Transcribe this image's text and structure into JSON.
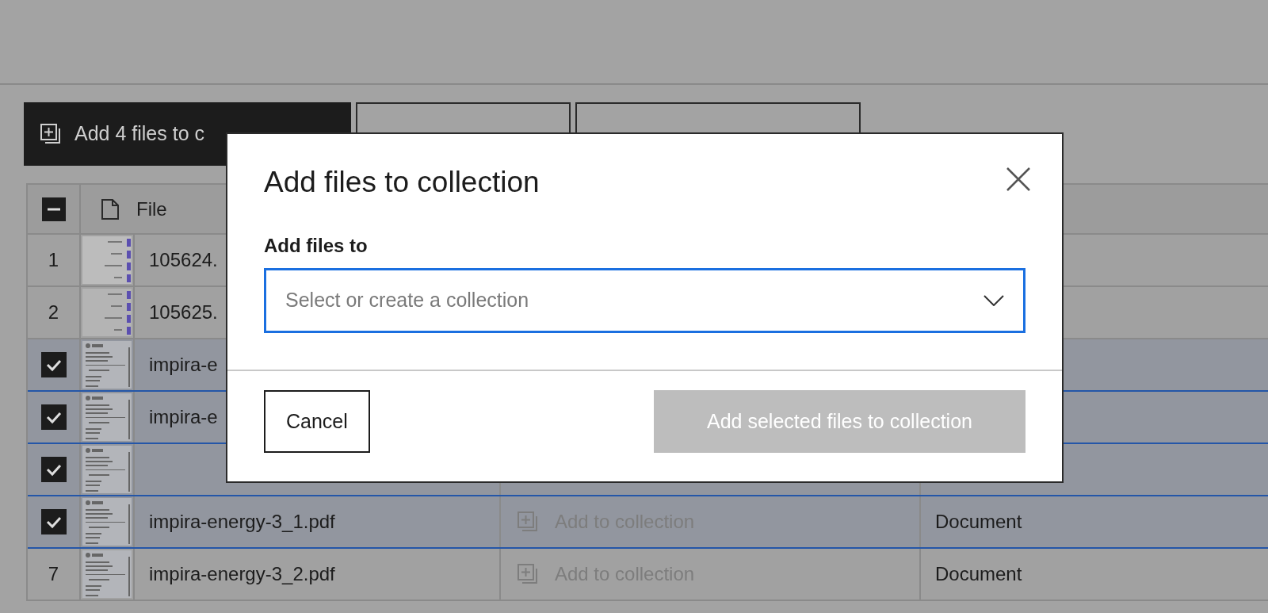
{
  "toolbar": {
    "add_button": "Add 4 files to c"
  },
  "table": {
    "header": {
      "indeterminate": true,
      "file_label": "File"
    },
    "rows": [
      {
        "number": "1",
        "selected": false,
        "kind": "chart",
        "file": "105624."
      },
      {
        "number": "2",
        "selected": false,
        "kind": "chart",
        "file": "105625."
      },
      {
        "selected": true,
        "kind": "letter",
        "file": "impira-e"
      },
      {
        "selected": true,
        "kind": "letter",
        "file": "impira-e"
      },
      {
        "selected": true,
        "kind": "letter"
      },
      {
        "selected": true,
        "kind": "letter",
        "file": "impira-energy-3_1.pdf",
        "collection": "Add to collection",
        "type": "Document"
      },
      {
        "number": "7",
        "selected": false,
        "kind": "letter",
        "file": "impira-energy-3_2.pdf",
        "collection": "Add to collection",
        "type": "Document"
      }
    ]
  },
  "dialog": {
    "title": "Add files to collection",
    "field_label": "Add files to",
    "select": {
      "placeholder": "Select or create a collection",
      "focused": true
    },
    "cancel": "Cancel",
    "confirm": {
      "label": "Add selected files to collection",
      "disabled": true
    }
  }
}
